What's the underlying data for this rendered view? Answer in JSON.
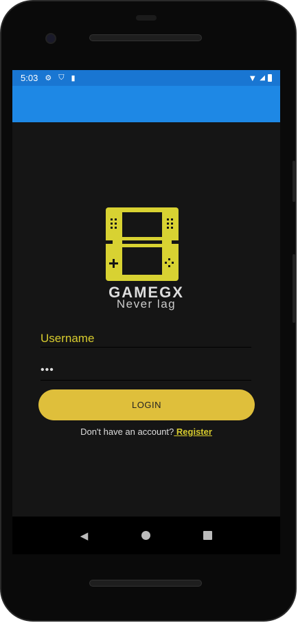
{
  "status_bar": {
    "time": "5:03",
    "icons": [
      "gear-icon",
      "shield-play-icon",
      "sd-card-icon",
      "wifi-icon",
      "signal-icon",
      "battery-icon"
    ]
  },
  "brand": {
    "name": "GAMEGX",
    "tagline": "Never lag",
    "logo_color": "#d8d232"
  },
  "form": {
    "username_placeholder": "Username",
    "password_value": "•••",
    "login_label": "LOGIN",
    "register_prompt": "Don't have an account?",
    "register_link": " Register"
  },
  "colors": {
    "accent": "#d8cc2e",
    "button": "#dfbf3b",
    "status_bar": "#1976d2",
    "app_bar": "#1e88e5",
    "background": "#151515"
  }
}
